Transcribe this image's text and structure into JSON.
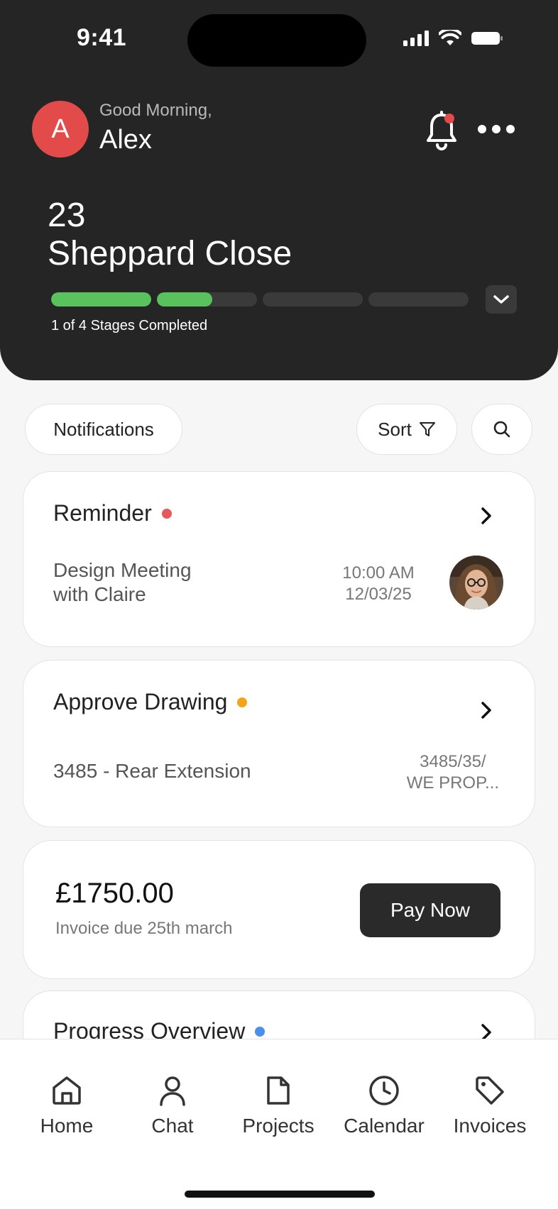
{
  "status_bar": {
    "time": "9:41"
  },
  "user": {
    "initial": "A",
    "greeting": "Good Morning,",
    "name": "Alex"
  },
  "project": {
    "address_line1": "23",
    "address_line2": "Sheppard Close",
    "stages_text": "1 of 4 Stages Completed",
    "stage_progress": [
      1.0,
      0.55,
      0,
      0
    ]
  },
  "filters": {
    "notifications_label": "Notifications",
    "sort_label": "Sort"
  },
  "cards": {
    "reminder": {
      "title": "Reminder",
      "dot_color": "#e25a5a",
      "line1": "Design Meeting",
      "line2": "with Claire",
      "time": "10:00 AM",
      "date": "12/03/25"
    },
    "drawing": {
      "title": "Approve Drawing",
      "dot_color": "#f2a51a",
      "subtitle": "3485 - Rear Extension",
      "ref_line1": "3485/35/",
      "ref_line2": "WE PROP..."
    },
    "invoice": {
      "amount": "£1750.00",
      "due": "Invoice due 25th march",
      "pay_label": "Pay Now"
    },
    "progress_overview": {
      "title": "Progress Overview",
      "dot_color": "#4a8ef0"
    }
  },
  "nav": {
    "home": "Home",
    "chat": "Chat",
    "projects": "Projects",
    "calendar": "Calendar",
    "invoices": "Invoices"
  },
  "colors": {
    "header_bg": "#252525",
    "progress_green": "#5ac25d",
    "avatar_red": "#e24b4a",
    "notification_dot": "#e24b4a"
  }
}
